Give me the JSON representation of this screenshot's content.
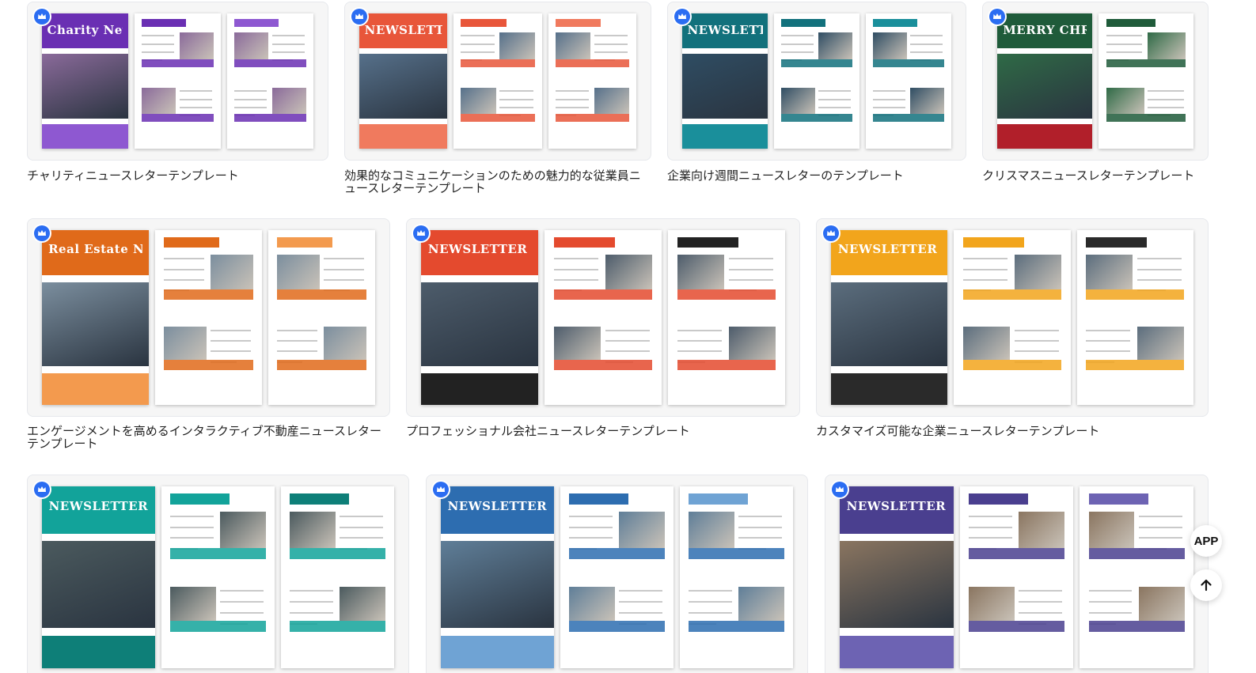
{
  "templates": [
    {
      "caption": "チャリティニュースレターテンプレート",
      "cover_title": "Charity Newsletter",
      "accent": "#6a2fb3",
      "accent2": "#8e58d1",
      "photo": "#8a6a9a"
    },
    {
      "caption": "効果的なコミュニケーションのための魅力的な従業員ニュースレターテンプレート",
      "cover_title": "NEWSLETTER",
      "accent": "#e8563a",
      "accent2": "#f07a5e",
      "photo": "#56708a"
    },
    {
      "caption": "企業向け週間ニュースレターのテンプレート",
      "cover_title": "NEWSLETTER",
      "accent": "#12717c",
      "accent2": "#1a8f9b",
      "photo": "#2f4d63"
    },
    {
      "caption": "クリスマスニュースレターテンプレート",
      "cover_title": "MERRY CHRISTMAS",
      "accent": "#1f5b3a",
      "accent2": "#b11f2a",
      "photo": "#2f6a46"
    },
    {
      "caption": "エンゲージメントを高めるインタラクティブ不動産ニュースレターテンプレート",
      "cover_title": "Real Estate Newsletter",
      "accent": "#e06a1a",
      "accent2": "#f39a4e",
      "photo": "#7b8e9e"
    },
    {
      "caption": "プロフェッショナル会社ニュースレターテンプレート",
      "cover_title": "NEWSLETTER",
      "accent": "#e44a2e",
      "accent2": "#222222",
      "photo": "#4d5c6b"
    },
    {
      "caption": "カスタマイズ可能な企業ニュースレターテンプレート",
      "cover_title": "NEWSLETTER",
      "accent": "#f2a51c",
      "accent2": "#2a2a2a",
      "photo": "#5b6d7d"
    },
    {
      "caption": "",
      "cover_title": "NEWSLETTER",
      "accent": "#12a39a",
      "accent2": "#0e7f78",
      "photo": "#4b5a5e"
    },
    {
      "caption": "",
      "cover_title": "NEWSLETTER",
      "accent": "#2d6db0",
      "accent2": "#6fa3d4",
      "photo": "#5f7e98"
    },
    {
      "caption": "",
      "cover_title": "NEWSLETTER",
      "accent": "#4a3f8f",
      "accent2": "#6d63b3",
      "photo": "#8a7560"
    }
  ],
  "premium_icon": "crown-icon",
  "fab": {
    "app_label": "APP",
    "top_icon": "arrow-up-icon"
  }
}
